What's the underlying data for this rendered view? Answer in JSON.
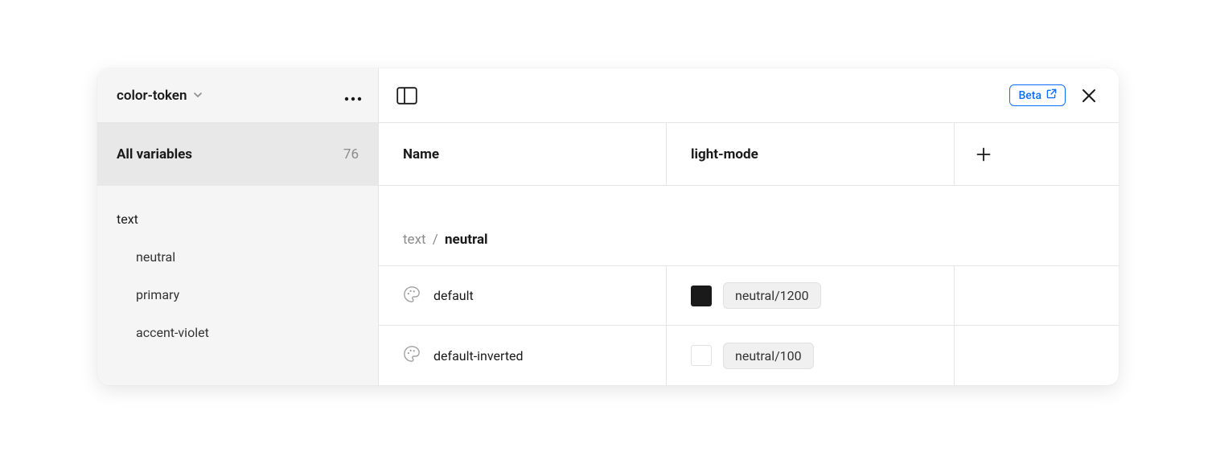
{
  "sidebar": {
    "collection_name": "color-token",
    "all_variables_label": "All variables",
    "all_variables_count": "76",
    "groups": [
      {
        "label": "text",
        "indent": 0
      },
      {
        "label": "neutral",
        "indent": 1
      },
      {
        "label": "primary",
        "indent": 1
      },
      {
        "label": "accent-violet",
        "indent": 1
      }
    ]
  },
  "toolbar": {
    "beta_label": "Beta"
  },
  "table": {
    "header_name": "Name",
    "header_mode": "light-mode",
    "breadcrumb_parent": "text",
    "breadcrumb_sep": "/",
    "breadcrumb_current": "neutral",
    "rows": [
      {
        "name": "default",
        "swatch_color": "dark",
        "token": "neutral/1200"
      },
      {
        "name": "default-inverted",
        "swatch_color": "light",
        "token": "neutral/100"
      }
    ]
  }
}
